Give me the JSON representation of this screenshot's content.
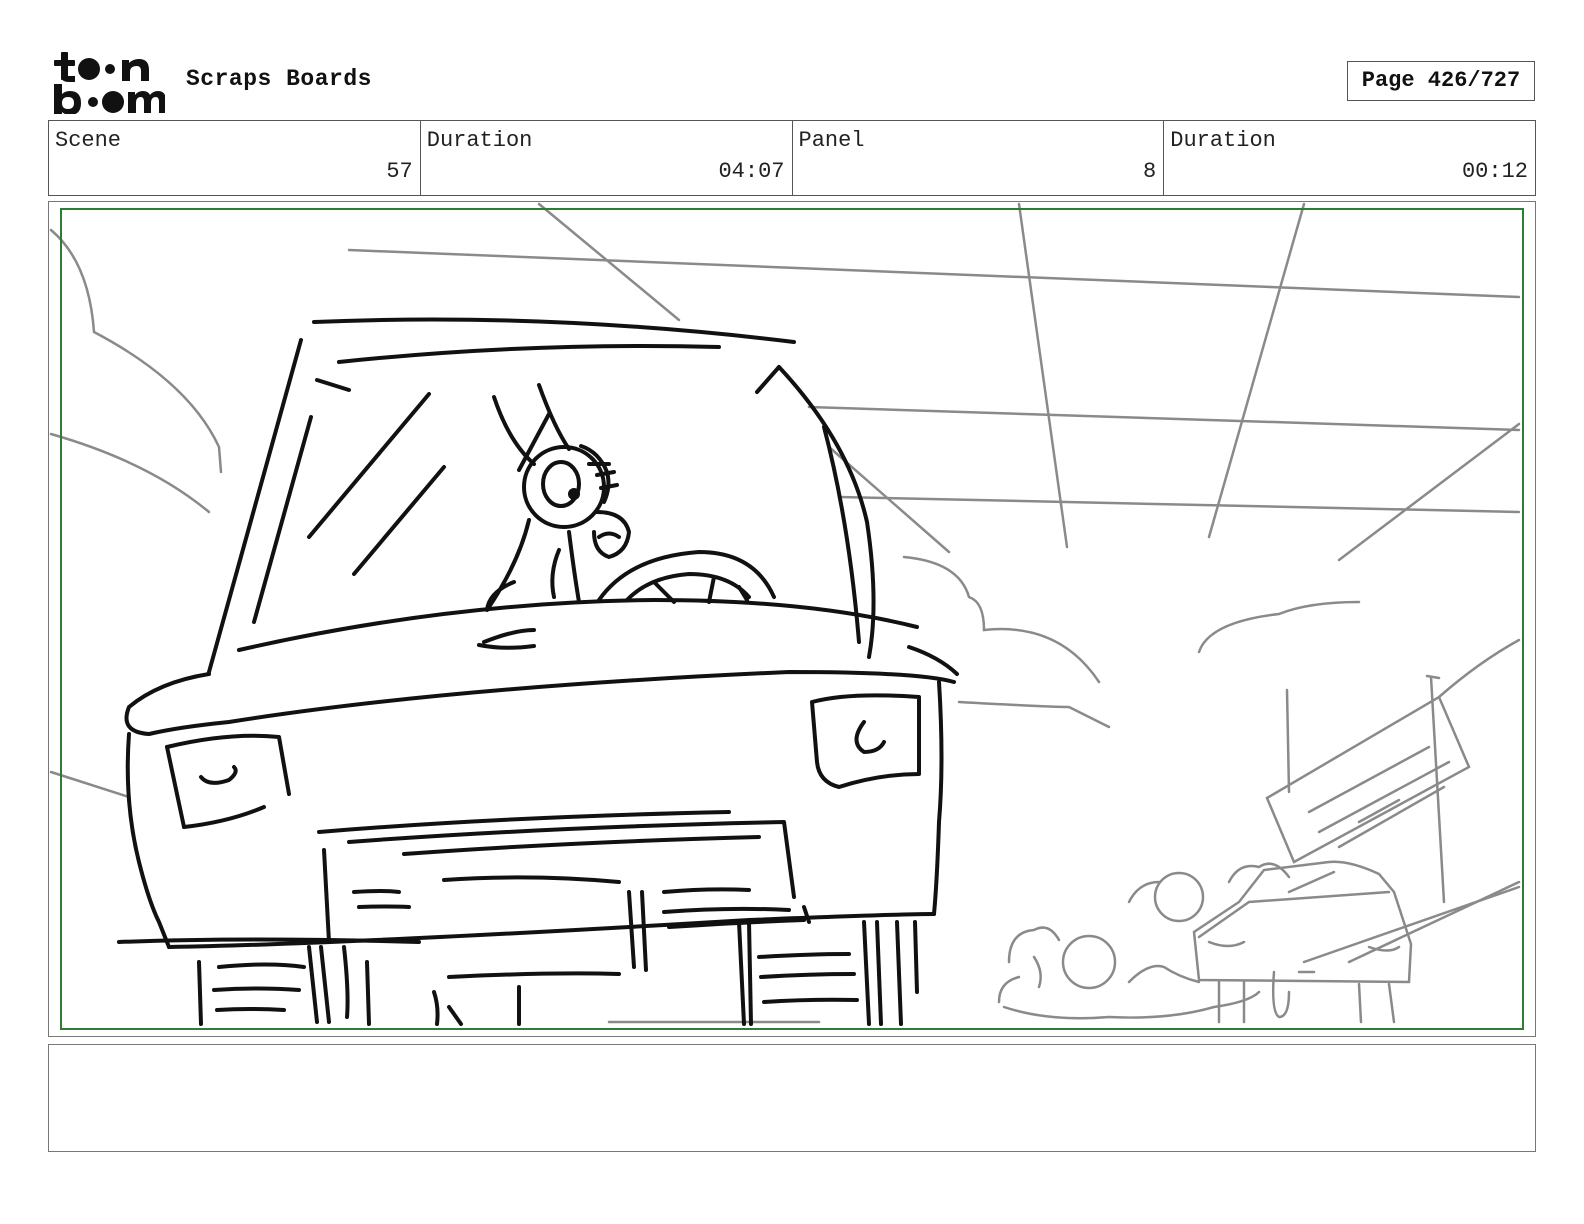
{
  "header": {
    "logo_icon": "toon-boom-logo",
    "project_title": "Scraps Boards",
    "page_indicator": "Page 426/727"
  },
  "info": {
    "scene_label": "Scene",
    "scene_value": "57",
    "scene_duration_label": "Duration",
    "scene_duration_value": "04:07",
    "panel_label": "Panel",
    "panel_value": "8",
    "panel_duration_label": "Duration",
    "panel_duration_value": "00:12"
  },
  "panel": {
    "image_icon": "storyboard-sketch",
    "safe_area_color": "#2e7d32"
  },
  "notes": {
    "text": ""
  }
}
